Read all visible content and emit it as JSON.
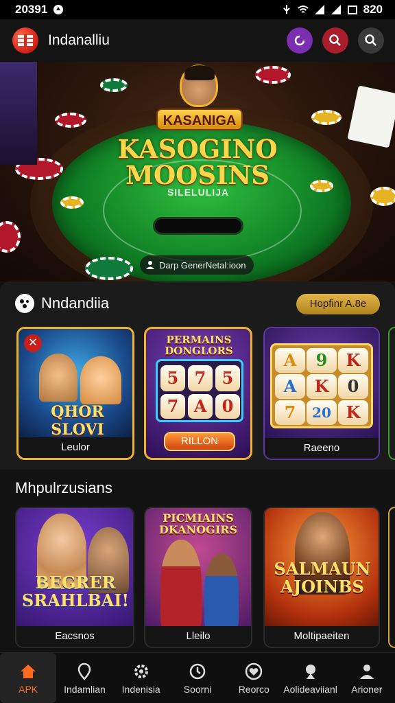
{
  "status_bar": {
    "time": "20391",
    "battery": "820"
  },
  "header": {
    "app_title": "Indanalliu"
  },
  "hero": {
    "badge": "KASANIGA",
    "title_line1": "KASOGINO",
    "title_line2": "MOOSINS",
    "subtitle": "SILELULIJA",
    "caption": "Darp GenerNetal:ioon"
  },
  "featured": {
    "title": "Nndandiia",
    "action_pill": "Hopfinr A.8e",
    "cards": [
      {
        "art_title": "QHOR SLOVI",
        "label": "Leulor"
      },
      {
        "art_title": "PERMAINS DONGLORS",
        "reels": [
          "5",
          "7",
          "5",
          "7",
          "A",
          "0"
        ],
        "button": "RILLON",
        "label": ""
      },
      {
        "reels": [
          "A",
          "9",
          "K",
          "A",
          "K",
          "0",
          "7",
          "20",
          "K"
        ],
        "label": "Raeeno"
      }
    ]
  },
  "multi": {
    "title": "Mhpulrzusians",
    "cards": [
      {
        "art_title": "BEGRER SRAHLBAI!",
        "label": "Eacsnos"
      },
      {
        "art_title": "PICMIAINS DKANOGIRS",
        "label": "Lleilo"
      },
      {
        "art_title": "SALMAUN AJOINBS",
        "label": "Moltipaeiten"
      }
    ]
  },
  "bottom_nav": [
    {
      "icon": "home-icon",
      "label": "APK",
      "active": true
    },
    {
      "icon": "map-pin-icon",
      "label": "Indamlian"
    },
    {
      "icon": "gear-icon",
      "label": "Indenisia"
    },
    {
      "icon": "clock-icon",
      "label": "Soorni"
    },
    {
      "icon": "heart-icon",
      "label": "Reorco"
    },
    {
      "icon": "trophy-icon",
      "label": "Aolideaviianl"
    },
    {
      "icon": "user-icon",
      "label": "Arioner"
    }
  ],
  "colors": {
    "accent": "#ff6a1f",
    "purple": "#7b2fb0",
    "red": "#a81e2a",
    "gold": "#e2b54a"
  }
}
